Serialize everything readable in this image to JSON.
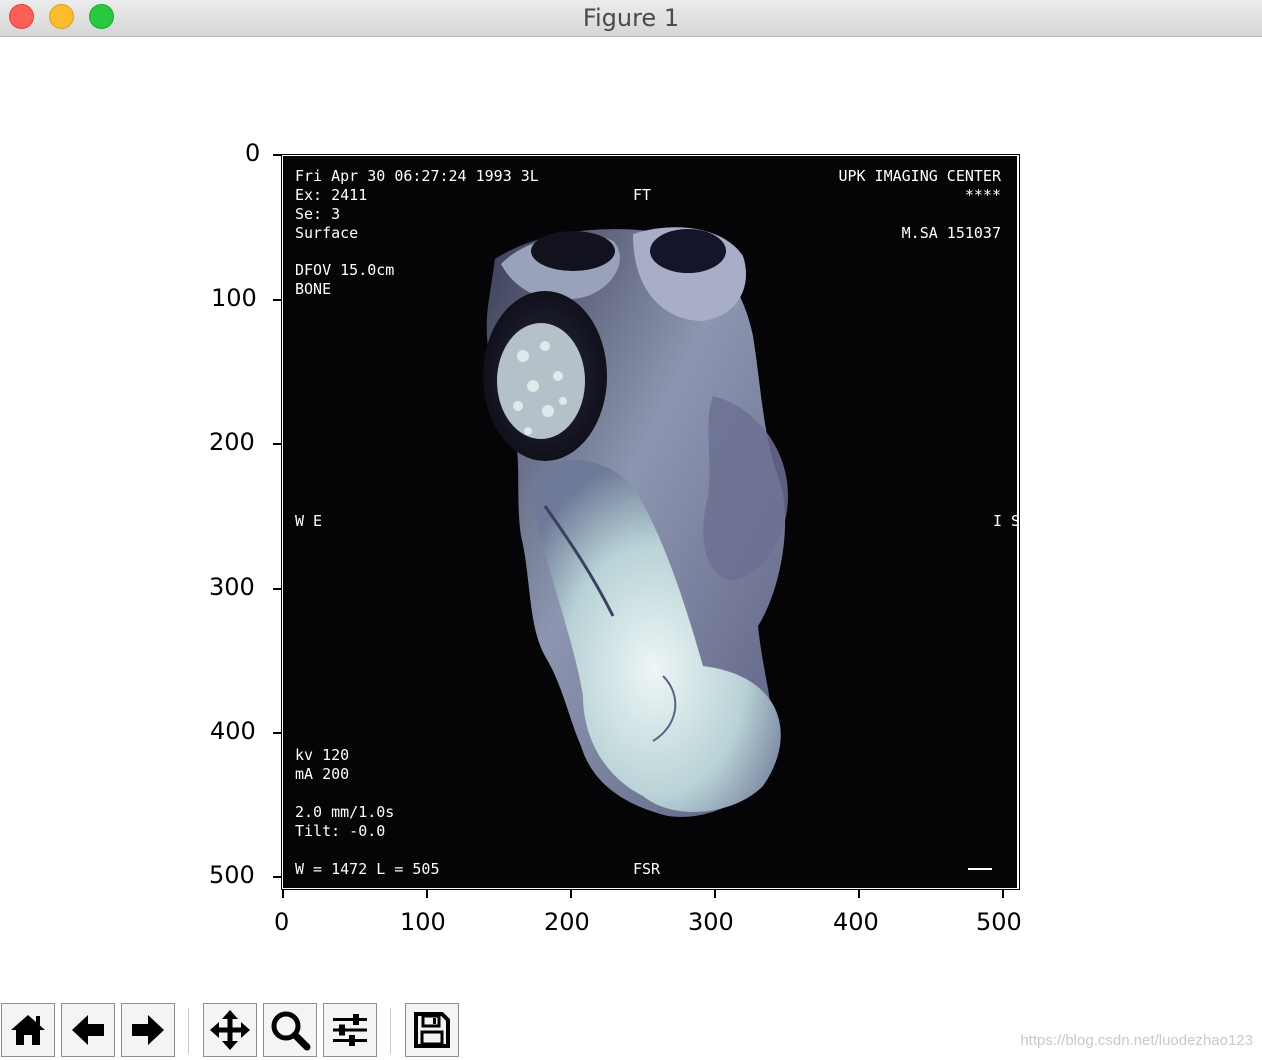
{
  "window": {
    "title": "Figure 1"
  },
  "axes": {
    "y_ticks": [
      "0",
      "100",
      "200",
      "300",
      "400",
      "500"
    ],
    "x_ticks": [
      "0",
      "100",
      "200",
      "300",
      "400",
      "500"
    ]
  },
  "image_overlay": {
    "top_left": [
      "Fri Apr 30 06:27:24 1993 3L",
      "Ex: 2411",
      "Se: 3",
      "Surface"
    ],
    "dfov": "DFOV 15.0cm",
    "bone": "BONE",
    "top_center": "FT",
    "top_right": [
      "UPK IMAGING CENTER",
      "****",
      "M.SA  151037"
    ],
    "left_mid": "W E",
    "right_mid": "I S",
    "bottom_left_a": [
      "kv 120",
      "mA 200"
    ],
    "bottom_left_b": [
      "2.0 mm/1.0s",
      "Tilt: -0.0"
    ],
    "bottom_line": "W = 1472 L = 505",
    "bottom_center": "FSR"
  },
  "toolbar": {
    "buttons": [
      "home-icon",
      "back-arrow-icon",
      "forward-arrow-icon",
      "pan-icon",
      "zoom-icon",
      "configure-subplots-icon",
      "save-icon"
    ]
  },
  "watermark": "https://blog.csdn.net/luodezhao123"
}
